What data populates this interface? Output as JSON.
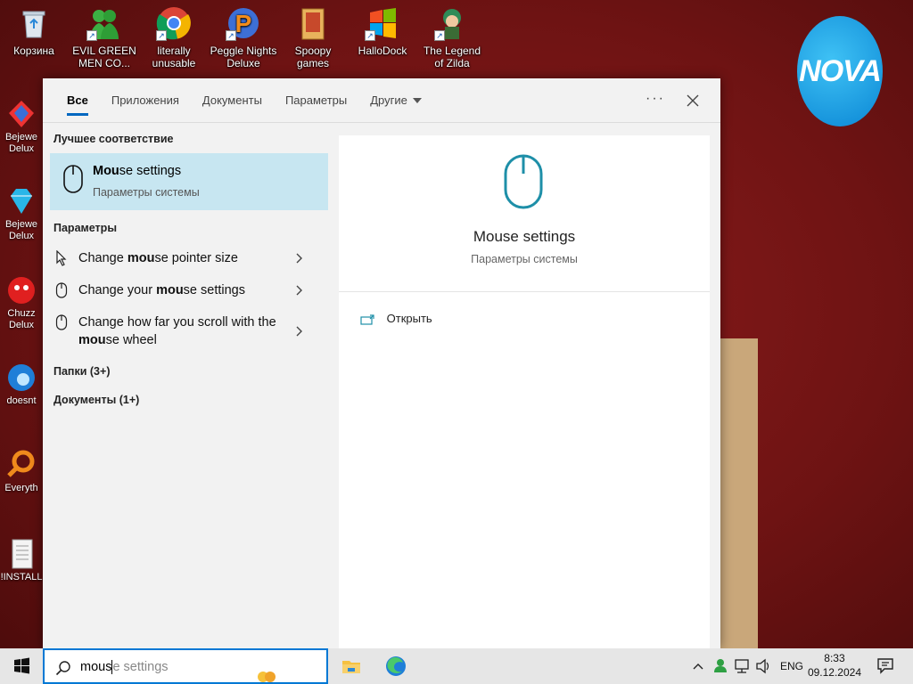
{
  "desktop": {
    "top_icons": [
      {
        "label": "Корзина",
        "icon": "recycle-bin-icon"
      },
      {
        "label": "EVIL GREEN MEN CO...",
        "icon": "green-men-icon"
      },
      {
        "label": "literally unusable",
        "icon": "chrome-icon"
      },
      {
        "label": "Peggle Nights Deluxe",
        "icon": "peggle-icon"
      },
      {
        "label": "Spoopy games",
        "icon": "folder-icon"
      },
      {
        "label": "HalloDock",
        "icon": "windows-logo-icon"
      },
      {
        "label": "The Legend of Zilda",
        "icon": "zelda-character-icon"
      }
    ],
    "left_icons": [
      {
        "label": "Bejewe Delux",
        "icon": "bejeweled-icon"
      },
      {
        "label": "Bejewe Delux",
        "icon": "diamond-icon"
      },
      {
        "label": "Chuzz Delux",
        "icon": "chuzzle-icon"
      },
      {
        "label": "doesnt",
        "icon": "edge-icon"
      },
      {
        "label": "Everyth",
        "icon": "magnifier-icon"
      },
      {
        "label": "!INSTALL",
        "icon": "text-file-icon"
      }
    ],
    "nova_logo": "NOVA"
  },
  "search_panel": {
    "tabs": [
      {
        "label": "Все",
        "active": true
      },
      {
        "label": "Приложения",
        "active": false
      },
      {
        "label": "Документы",
        "active": false
      },
      {
        "label": "Параметры",
        "active": false
      },
      {
        "label": "Другие",
        "active": false
      }
    ],
    "more_label": "···",
    "best_match_title": "Лучшее соответствие",
    "best_match": {
      "title_bold": "Mou",
      "title_rest": "se settings",
      "subtitle": "Параметры системы"
    },
    "settings_title": "Параметры",
    "settings_items": [
      {
        "pre": "Change ",
        "bold": "mou",
        "post": "se pointer size",
        "icon": "mouse-pointer-icon"
      },
      {
        "pre": "Change your ",
        "bold": "mou",
        "post": "se settings",
        "icon": "mouse-icon"
      },
      {
        "pre": "Change how far you scroll with the ",
        "bold": "mou",
        "post": "se wheel",
        "icon": "mouse-icon"
      }
    ],
    "folders_label": "Папки (3+)",
    "documents_label": "Документы (1+)",
    "preview": {
      "title": "Mouse settings",
      "subtitle": "Параметры системы",
      "open_label": "Открыть"
    }
  },
  "taskbar": {
    "search_typed": "mous",
    "search_ghost": "e settings",
    "language": "ENG",
    "time": "8:33",
    "date": "09.12.2024"
  },
  "colors": {
    "accent": "#0078d4",
    "best_match_bg": "#c7e6f1",
    "icon_teal": "#1e8fa8"
  }
}
